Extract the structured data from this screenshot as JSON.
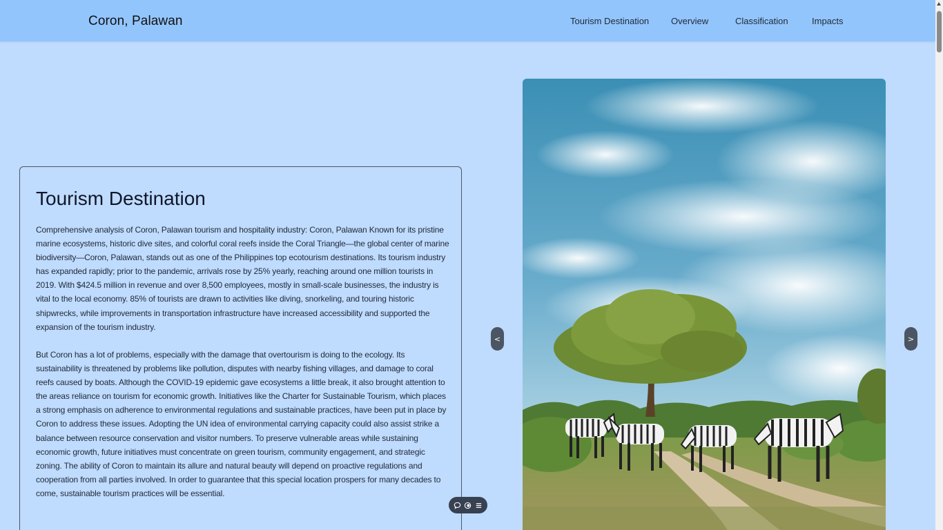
{
  "header": {
    "brand": "Coron, Palawan",
    "nav": [
      "Tourism Destination",
      "Overview",
      "Classification",
      "Impacts"
    ]
  },
  "section": {
    "title": "Tourism Destination",
    "paragraph_1": "Comprehensive analysis of Coron, Palawan tourism and hospitality industry: Coron, Palawan Known for its pristine marine ecosystems, historic dive sites, and colorful coral reefs inside the Coral Triangle—the global center of marine biodiversity—Coron, Palawan, stands out as one of the Philippines top ecotourism destinations. Its tourism industry has expanded rapidly; prior to the pandemic, arrivals rose by 25% yearly, reaching around one million tourists in 2019. With $424.5 million in revenue and over 8,500 employees, mostly in small-scale businesses, the industry is vital to the local economy. 85% of tourists are drawn to activities like diving, snorkeling, and touring historic shipwrecks, while improvements in transportation infrastructure have increased accessibility and supported the expansion of the tourism industry.",
    "paragraph_2": "But Coron has a lot of problems, especially with the damage that overtourism is doing to the ecology. Its sustainability is threatened by problems like pollution, disputes with nearby fishing villages, and damage to coral reefs caused by boats. Although the COVID-19 epidemic gave ecosystems a little break, it also brought attention to the areas reliance on tourism for economic growth. Initiatives like the Charter for Sustainable Tourism, which places a strong emphasis on adherence to environmental regulations and sustainable practices, have been put in place by Coron to address these issues. Adopting the UN idea of environmental carrying capacity could also assist strike a balance between resource conservation and visitor numbers. To preserve vulnerable areas while sustaining economic growth, future initiatives must concentrate on green tourism, community engagement, and strategic zoning. The ability of Coron to maintain its allure and natural beauty will depend on proactive regulations and cooperation from all parties involved. In order to guarantee that this special location prospers for many decades to come, sustainable tourism practices will be essential."
  },
  "carousel": {
    "prev_label": "<",
    "next_label": ">"
  },
  "toolbar": {
    "icons": [
      "comment-icon",
      "toggle-icon",
      "menu-icon"
    ]
  },
  "colors": {
    "page_bg": "#bfdbfe",
    "navbar_bg": "#93c5fd",
    "button_bg": "#4b5563",
    "toolbar_bg": "#374151"
  }
}
